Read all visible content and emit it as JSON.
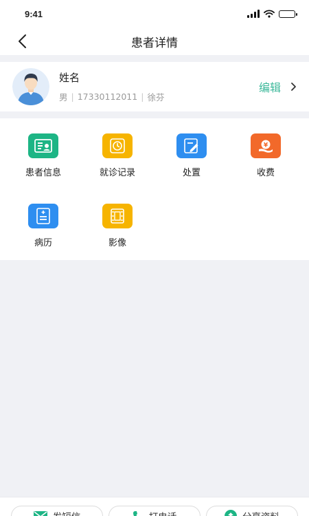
{
  "status_bar": {
    "time": "9:41"
  },
  "nav": {
    "title": "患者详情"
  },
  "profile": {
    "name": "姓名",
    "gender": "男",
    "phone": "17330112011",
    "doctor": "徐芬",
    "edit_label": "编辑"
  },
  "functions": [
    {
      "label": "患者信息",
      "icon": "id-card-icon",
      "color": "#1db585"
    },
    {
      "label": "就诊记录",
      "icon": "clock-icon",
      "color": "#f6b400"
    },
    {
      "label": "处置",
      "icon": "edit-note-icon",
      "color": "#2e8ef0"
    },
    {
      "label": "收费",
      "icon": "yuan-coin-icon",
      "color": "#f2692a"
    },
    {
      "label": "病历",
      "icon": "medical-record-icon",
      "color": "#2e8ef0"
    },
    {
      "label": "影像",
      "icon": "film-icon",
      "color": "#f6b400"
    }
  ],
  "bottom_actions": {
    "sms": "发短信",
    "call": "打电话",
    "share": "分享资料"
  },
  "colors": {
    "accent": "#3cb89a",
    "page_bg": "#f0f1f5"
  }
}
